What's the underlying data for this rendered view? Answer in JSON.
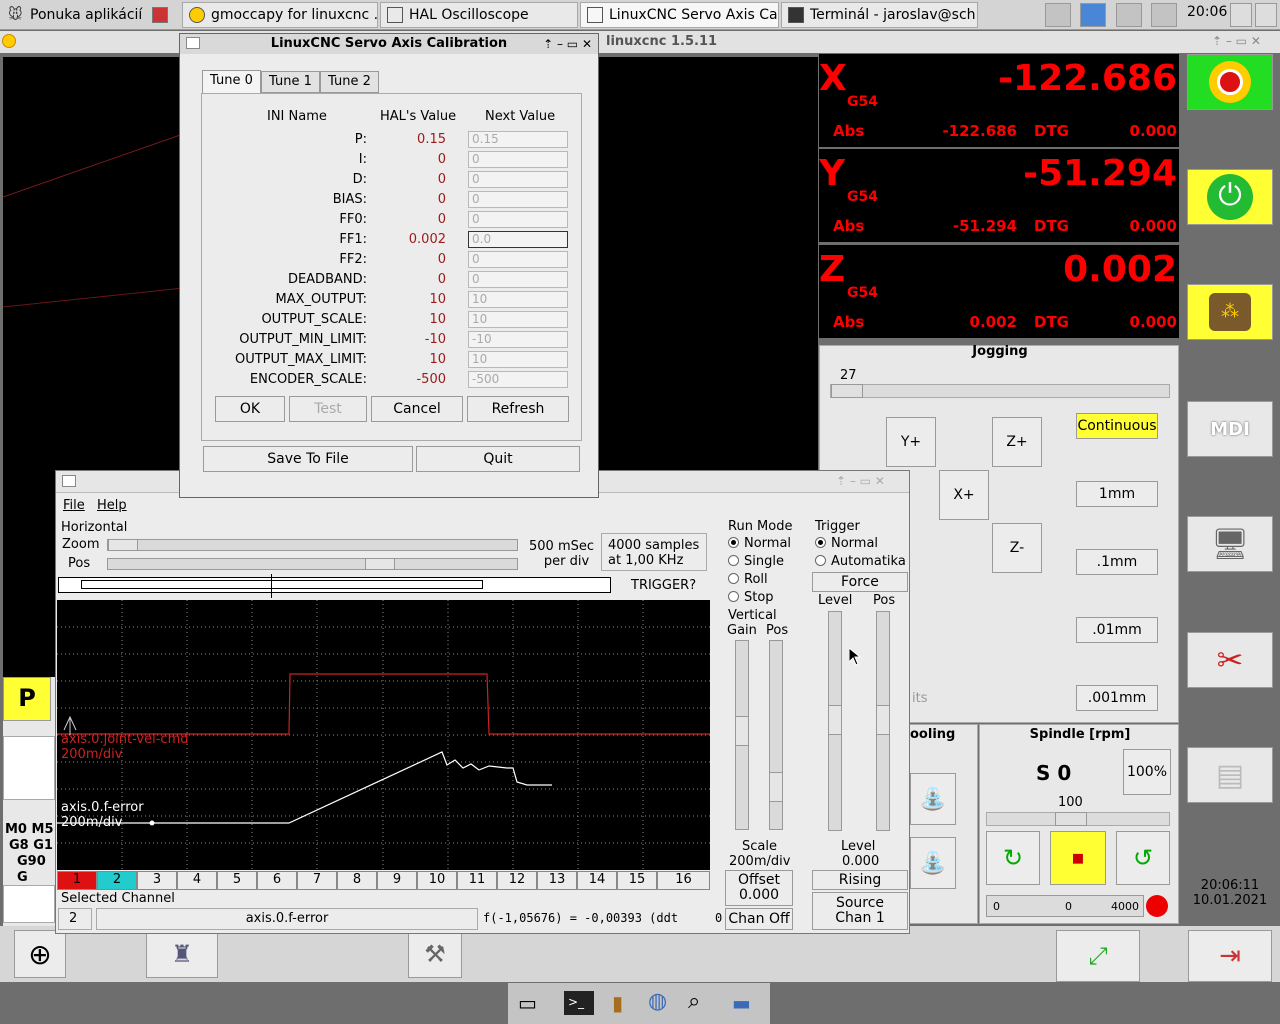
{
  "taskbar": {
    "apps_menu": "Ponuka aplikácií",
    "tasks": [
      "gmoccapy for linuxcnc ...",
      "HAL Oscilloscope",
      "LinuxCNC Servo Axis Ca...",
      "Terminál - jaroslav@sch..."
    ],
    "clock": "20:06"
  },
  "gmoccapy": {
    "title": "linuxcnc  1.5.11",
    "dro": [
      {
        "axis": "X",
        "wcs": "G54",
        "value": "-122.686",
        "abs_label": "Abs",
        "abs": "-122.686",
        "dtg_label": "DTG",
        "dtg": "0.000"
      },
      {
        "axis": "Y",
        "wcs": "G54",
        "value": "-51.294",
        "abs_label": "Abs",
        "abs": "-51.294",
        "dtg_label": "DTG",
        "dtg": "0.000"
      },
      {
        "axis": "Z",
        "wcs": "G54",
        "value": "0.002",
        "abs_label": "Abs",
        "abs": "0.002",
        "dtg_label": "DTG",
        "dtg": "0.000"
      }
    ],
    "jogging": {
      "title": "Jogging",
      "speed": "27",
      "buttons": {
        "y_plus": "Y+",
        "z_plus": "Z+",
        "x_plus": "X+",
        "z_minus": "Z-"
      },
      "increments": [
        "Continuous",
        "1mm",
        ".1mm",
        ".01mm",
        ".001mm"
      ],
      "limits_partial": "its"
    },
    "tooling": "ooling",
    "spindle": {
      "title": "Spindle [rpm]",
      "speed": "S 0",
      "override_btn": "100%",
      "override_value": "100",
      "bar_min": "0",
      "bar_value": "0",
      "bar_max": "4000"
    },
    "gcodes": [
      "M0 M5",
      "G8 G1",
      "G90 G"
    ],
    "side_labels": {
      "mdi": "MDI"
    },
    "datetime": {
      "time": "20:06:11",
      "date": "10.01.2021"
    },
    "colors": {
      "dro_red": "#ff0000",
      "estop_green": "#22dd22",
      "continuous_yellow": "#ffff33"
    }
  },
  "calibration": {
    "title": "LinuxCNC Servo Axis Calibration",
    "tabs": [
      "Tune 0",
      "Tune 1",
      "Tune 2"
    ],
    "headers": {
      "name": "INI Name",
      "hal": "HAL's Value",
      "next": "Next Value"
    },
    "params": [
      {
        "name": "P:",
        "hal": "0.15",
        "next": "0.15"
      },
      {
        "name": "I:",
        "hal": "0",
        "next": "0"
      },
      {
        "name": "D:",
        "hal": "0",
        "next": "0"
      },
      {
        "name": "BIAS:",
        "hal": "0",
        "next": "0"
      },
      {
        "name": "FF0:",
        "hal": "0",
        "next": "0"
      },
      {
        "name": "FF1:",
        "hal": "0.002",
        "next": "0.0"
      },
      {
        "name": "FF2:",
        "hal": "0",
        "next": "0"
      },
      {
        "name": "DEADBAND:",
        "hal": "0",
        "next": "0"
      },
      {
        "name": "MAX_OUTPUT:",
        "hal": "10",
        "next": "10"
      },
      {
        "name": "OUTPUT_SCALE:",
        "hal": "10",
        "next": "10"
      },
      {
        "name": "OUTPUT_MIN_LIMIT:",
        "hal": "-10",
        "next": "-10"
      },
      {
        "name": "OUTPUT_MAX_LIMIT:",
        "hal": "10",
        "next": "10"
      },
      {
        "name": "ENCODER_SCALE:",
        "hal": "-500",
        "next": "-500"
      }
    ],
    "buttons": {
      "ok": "OK",
      "test": "Test",
      "cancel": "Cancel",
      "refresh": "Refresh",
      "save": "Save To File",
      "quit": "Quit"
    }
  },
  "halscope": {
    "menu": {
      "file": "File",
      "help": "Help"
    },
    "horizontal": {
      "title": "Horizontal",
      "zoom": "Zoom",
      "pos": "Pos",
      "rate1": "500 mSec",
      "rate2": "per div",
      "samples1": "4000 samples",
      "samples2": "at 1,00 KHz",
      "trigger_status": "TRIGGER?"
    },
    "run_mode": {
      "title": "Run Mode",
      "options": [
        "Normal",
        "Single",
        "Roll",
        "Stop"
      ],
      "selected": "Normal"
    },
    "trigger": {
      "title": "Trigger",
      "options": [
        "Normal",
        "Automatika"
      ],
      "selected": "Normal",
      "force": "Force",
      "level_label": "Level",
      "pos_label": "Pos",
      "level_title": "Level",
      "level_value": "0.000",
      "edge": "Rising",
      "source1": "Source",
      "source2": "Chan  1"
    },
    "vertical": {
      "title": "Vertical",
      "gain": "Gain",
      "pos": "Pos",
      "scale_label": "Scale",
      "scale_value": "200m/div",
      "offset_label": "Offset",
      "offset_value": "0.000",
      "chan_off": "Chan Off"
    },
    "traces": [
      {
        "name": "axis.0.joint-vel-cmd",
        "scale": "200m/div",
        "color": "#cc2222"
      },
      {
        "name": "axis.0.f-error",
        "scale": "200m/div",
        "color": "#ffffff"
      }
    ],
    "channels": [
      "1",
      "2",
      "3",
      "4",
      "5",
      "6",
      "7",
      "8",
      "9",
      "10",
      "11",
      "12",
      "13",
      "14",
      "15",
      "16"
    ],
    "channel_colors": {
      "1": "#dd1111",
      "2": "#22cccc"
    },
    "selected_channel": {
      "label": "Selected Channel",
      "number": "2",
      "name": "axis.0.f-error",
      "readout": "f(-1,05676) = -0,00393 (ddt",
      "extra": "0"
    }
  }
}
